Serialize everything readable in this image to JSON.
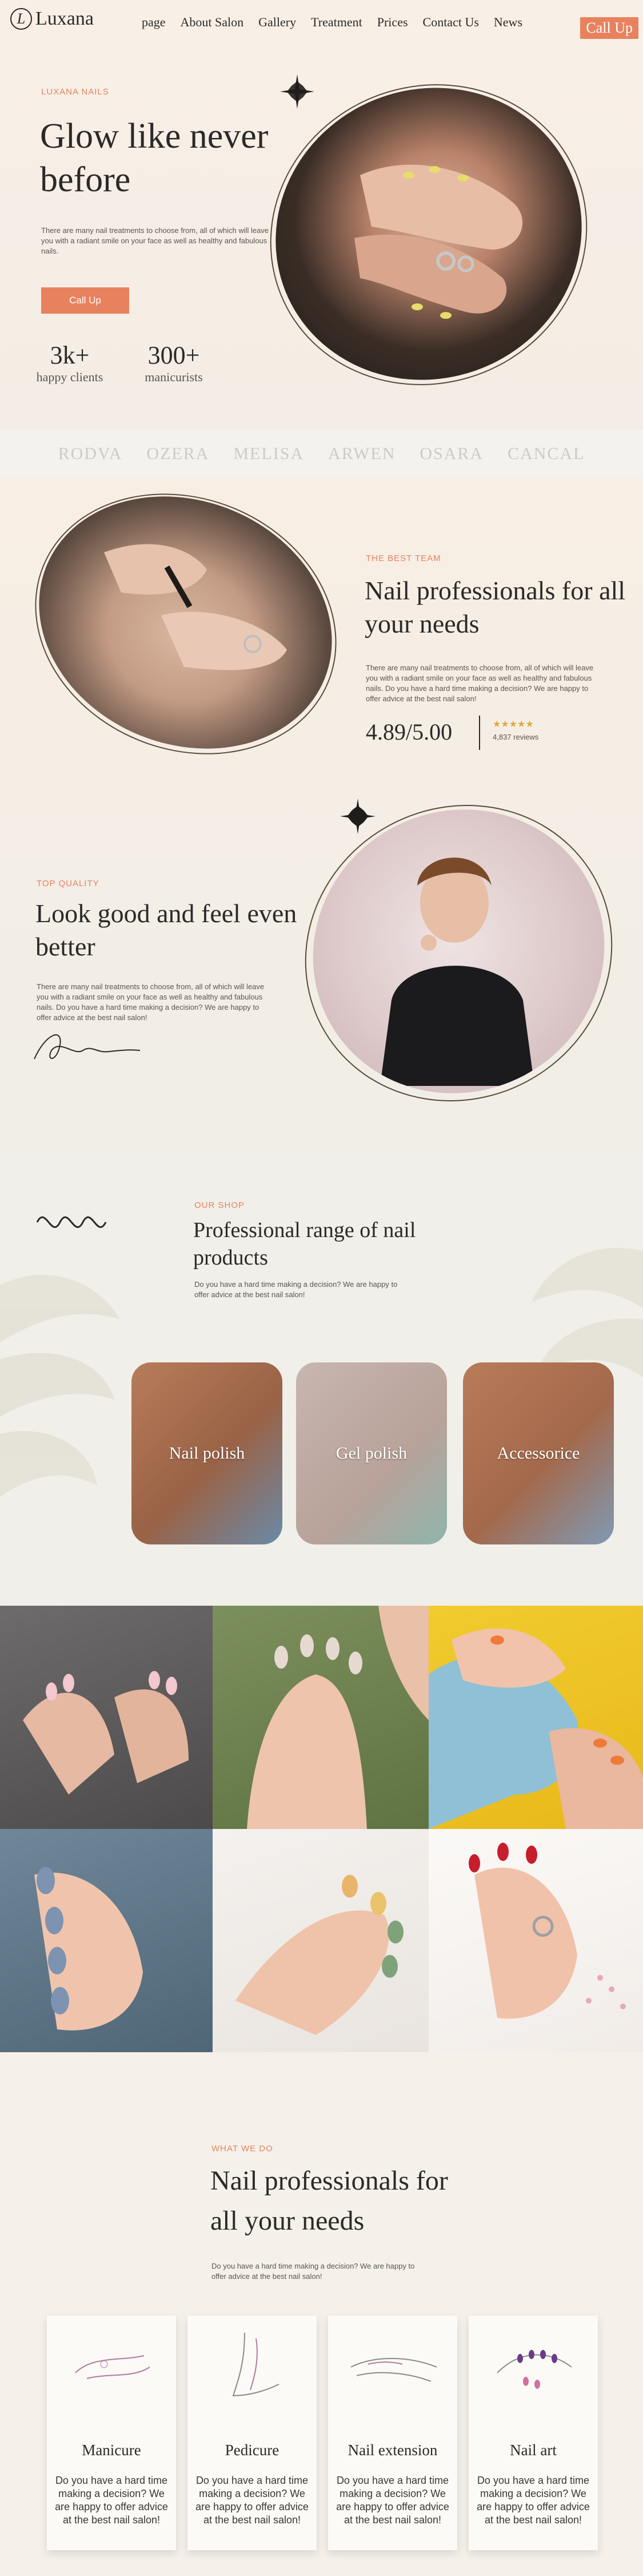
{
  "header": {
    "logo_mark": "L",
    "logo_text": "Luxana",
    "nav": [
      "page",
      "About Salon",
      "Gallery",
      "Treatment",
      "Prices",
      "Contact Us",
      "News"
    ],
    "cta": "Call Up"
  },
  "hero": {
    "eyebrow": "LUXANA NAILS",
    "title": "Glow like never before",
    "text": "There are many nail treatments to choose from, all of which will leave you with a radiant smile on your face as well as healthy and fabulous nails.",
    "button": "Call Up",
    "stats": [
      {
        "num": "3k+",
        "label": "happy clients"
      },
      {
        "num": "300+",
        "label": "manicurists"
      }
    ]
  },
  "brands": [
    "RODVA",
    "OZERA",
    "MELISA",
    "ARWEN",
    "OSARA",
    "CANCAL"
  ],
  "team": {
    "eyebrow": "THE BEST TEAM",
    "title": "Nail professionals for all your needs",
    "text": "There are many nail treatments to choose from, all of which will leave you with a radiant smile on your face as well as healthy and fabulous nails. Do you have a hard time making a decision? We are happy to offer advice at the best nail salon!",
    "rating": "4.89/5.00",
    "stars": "★★★★★",
    "reviews": "4,837 reviews"
  },
  "quality": {
    "eyebrow": "TOP QUALITY",
    "title": "Look good and feel even better",
    "text": "There are many nail treatments to choose from, all of which will leave you with a radiant smile on your face as well as healthy and fabulous nails. Do you have a hard time making a decision? We are happy to offer advice at the best nail salon!"
  },
  "shop": {
    "eyebrow": "OUR SHOP",
    "title": "Professional range of nail products",
    "text": "Do you have a hard time making a decision? We are happy to offer advice at the best nail salon!",
    "cards": [
      "Nail polish",
      "Gel polish",
      "Accessorice"
    ]
  },
  "services": {
    "eyebrow": "WHAT WE DO",
    "title": "Nail professionals for all your needs",
    "text": "Do you have a hard time making a decision? We are happy to offer advice at the best nail salon!",
    "items": [
      {
        "name": "Manicure",
        "desc": "Do you have a hard time making a decision? We are happy to offer advice at the best nail salon!"
      },
      {
        "name": "Pedicure",
        "desc": "Do you have a hard time making a decision? We are happy to offer advice at the best nail salon!"
      },
      {
        "name": "Nail extension",
        "desc": "Do you have a hard time making a decision? We are happy to offer advice at the best nail salon!"
      },
      {
        "name": "Nail art",
        "desc": "Do you have a hard time making a decision? We are happy to offer advice at the best nail salon!"
      }
    ]
  },
  "colors": {
    "accent": "#e8825e",
    "ink": "#2b2a28",
    "background": "#f7f1ea"
  }
}
